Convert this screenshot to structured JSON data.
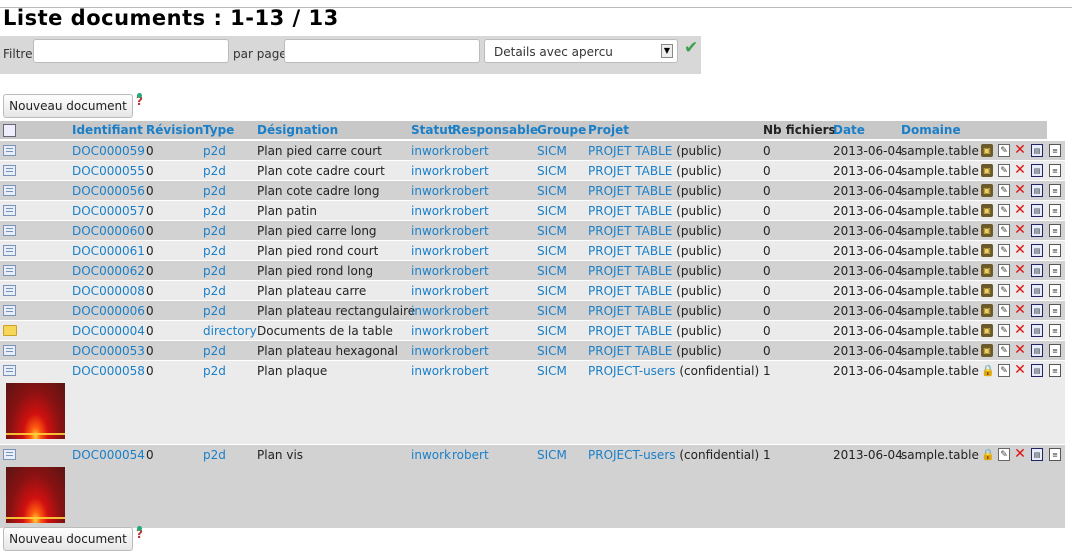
{
  "page": {
    "title": "Liste documents : 1-13 / 13"
  },
  "filters": {
    "filter_label": "Filtre",
    "filter_value": "",
    "per_page_label": "par page",
    "per_page_value": "",
    "view_mode": "Details avec apercu"
  },
  "actions": {
    "new_document_label": "Nouveau document"
  },
  "columns": {
    "identifiant": "Identifiant",
    "revision": "Révision",
    "type": "Type",
    "designation": "Désignation",
    "statut": "Statut",
    "responsable": "Responsable",
    "groupe": "Groupe",
    "projet": "Projet",
    "nb_fichiers": "Nb fichiers",
    "date": "Date",
    "domaine": "Domaine"
  },
  "rows": [
    {
      "icon": "document",
      "id": "DOC000059",
      "rev": "0",
      "type": "p2d",
      "designation": "Plan pied carre court",
      "status": "inwork",
      "owner": "robert",
      "group": "SICM",
      "project": "PROJET TABLE",
      "visibility": "(public)",
      "files": "0",
      "date": "2013-06-04",
      "domain": "sample.table",
      "state_icon": "template"
    },
    {
      "icon": "document",
      "id": "DOC000055",
      "rev": "0",
      "type": "p2d",
      "designation": "Plan cote cadre court",
      "status": "inwork",
      "owner": "robert",
      "group": "SICM",
      "project": "PROJET TABLE",
      "visibility": "(public)",
      "files": "0",
      "date": "2013-06-04",
      "domain": "sample.table",
      "state_icon": "template"
    },
    {
      "icon": "document",
      "id": "DOC000056",
      "rev": "0",
      "type": "p2d",
      "designation": "Plan cote cadre long",
      "status": "inwork",
      "owner": "robert",
      "group": "SICM",
      "project": "PROJET TABLE",
      "visibility": "(public)",
      "files": "0",
      "date": "2013-06-04",
      "domain": "sample.table",
      "state_icon": "template"
    },
    {
      "icon": "document",
      "id": "DOC000057",
      "rev": "0",
      "type": "p2d",
      "designation": "Plan patin",
      "status": "inwork",
      "owner": "robert",
      "group": "SICM",
      "project": "PROJET TABLE",
      "visibility": "(public)",
      "files": "0",
      "date": "2013-06-04",
      "domain": "sample.table",
      "state_icon": "template"
    },
    {
      "icon": "document",
      "id": "DOC000060",
      "rev": "0",
      "type": "p2d",
      "designation": "Plan pied carre long",
      "status": "inwork",
      "owner": "robert",
      "group": "SICM",
      "project": "PROJET TABLE",
      "visibility": "(public)",
      "files": "0",
      "date": "2013-06-04",
      "domain": "sample.table",
      "state_icon": "template"
    },
    {
      "icon": "document",
      "id": "DOC000061",
      "rev": "0",
      "type": "p2d",
      "designation": "Plan pied rond court",
      "status": "inwork",
      "owner": "robert",
      "group": "SICM",
      "project": "PROJET TABLE",
      "visibility": "(public)",
      "files": "0",
      "date": "2013-06-04",
      "domain": "sample.table",
      "state_icon": "template"
    },
    {
      "icon": "document",
      "id": "DOC000062",
      "rev": "0",
      "type": "p2d",
      "designation": "Plan pied rond long",
      "status": "inwork",
      "owner": "robert",
      "group": "SICM",
      "project": "PROJET TABLE",
      "visibility": "(public)",
      "files": "0",
      "date": "2013-06-04",
      "domain": "sample.table",
      "state_icon": "template"
    },
    {
      "icon": "document",
      "id": "DOC000008",
      "rev": "0",
      "type": "p2d",
      "designation": "Plan plateau carre",
      "status": "inwork",
      "owner": "robert",
      "group": "SICM",
      "project": "PROJET TABLE",
      "visibility": "(public)",
      "files": "0",
      "date": "2013-06-04",
      "domain": "sample.table",
      "state_icon": "template"
    },
    {
      "icon": "document",
      "id": "DOC000006",
      "rev": "0",
      "type": "p2d",
      "designation": "Plan plateau rectangulaire",
      "status": "inwork",
      "owner": "robert",
      "group": "SICM",
      "project": "PROJET TABLE",
      "visibility": "(public)",
      "files": "0",
      "date": "2013-06-04",
      "domain": "sample.table",
      "state_icon": "template"
    },
    {
      "icon": "folder",
      "id": "DOC000004",
      "rev": "0",
      "type": "directory",
      "designation": "Documents de la table",
      "status": "inwork",
      "owner": "robert",
      "group": "SICM",
      "project": "PROJET TABLE",
      "visibility": "(public)",
      "files": "0",
      "date": "2013-06-04",
      "domain": "sample.table",
      "state_icon": "template"
    },
    {
      "icon": "document",
      "id": "DOC000053",
      "rev": "0",
      "type": "p2d",
      "designation": "Plan plateau hexagonal",
      "status": "inwork",
      "owner": "robert",
      "group": "SICM",
      "project": "PROJET TABLE",
      "visibility": "(public)",
      "files": "0",
      "date": "2013-06-04",
      "domain": "sample.table",
      "state_icon": "template"
    },
    {
      "icon": "document",
      "id": "DOC000058",
      "rev": "0",
      "type": "p2d",
      "designation": "Plan plaque",
      "status": "inwork",
      "owner": "robert",
      "group": "SICM",
      "project": "PROJECT-users",
      "visibility": "(confidential)",
      "files": "1",
      "date": "2013-06-04",
      "domain": "sample.table",
      "state_icon": "lock",
      "thumbnail": true
    },
    {
      "icon": "document",
      "id": "DOC000054",
      "rev": "0",
      "type": "p2d",
      "designation": "Plan vis",
      "status": "inwork",
      "owner": "robert",
      "group": "SICM",
      "project": "PROJECT-users",
      "visibility": "(confidential)",
      "files": "1",
      "date": "2013-06-04",
      "domain": "sample.table",
      "state_icon": "lock",
      "thumbnail": true
    }
  ],
  "icons": {
    "row_actions": [
      "template-icon",
      "edit-icon",
      "delete-icon",
      "copy-icon",
      "clipboard-icon"
    ],
    "ok": "check-icon",
    "help": "help-icon"
  },
  "colors": {
    "link": "#1a7fc8",
    "header_bg": "#c8c8c8",
    "row_dark": "#d2d2d2",
    "row_light": "#ebebeb",
    "delete": "#d11"
  }
}
